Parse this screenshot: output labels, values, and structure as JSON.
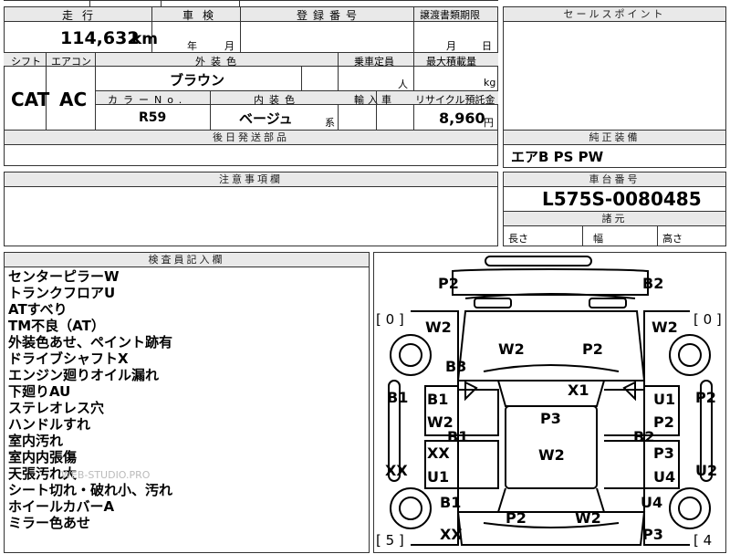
{
  "top_sheet": {
    "mileage_label": "走行",
    "inspection_label": "車検",
    "registration_label": "登録番号",
    "transfer_deadline_label": "譲渡書類期限",
    "mileage_value": "114,632",
    "mileage_unit": "km",
    "inspection_year_unit": "年",
    "inspection_month_unit": "月",
    "transfer_month_unit": "月",
    "transfer_day_unit": "日",
    "shift_label": "シフト",
    "aircon_label": "エアコン",
    "exterior_color_label": "外装色",
    "capacity_label": "乗車定員",
    "max_load_label": "最大積載量",
    "shift_value": "CAT",
    "aircon_value": "AC",
    "exterior_color_value": "ブラウン",
    "capacity_unit": "人",
    "max_load_unit": "kg",
    "color_no_label": "カラーNo.",
    "interior_color_label": "内装色",
    "import_label": "輸入車",
    "recycle_label": "リサイクル預託金",
    "color_no_value": "R59",
    "interior_color_value": "ベージュ",
    "interior_color_suffix": "系",
    "recycle_value": "8,960",
    "recycle_unit": "円",
    "later_parts_label": "後日発送部品",
    "notes_label": "注意事項欄"
  },
  "sales_point": {
    "label": "セールスポイント",
    "equipment_label": "純正装備",
    "equipment_value": "エアB PS PW"
  },
  "chassis": {
    "label": "車台番号",
    "value": "L575S-0080485",
    "dimensions_label": "諸元",
    "length_label": "長さ",
    "width_label": "幅",
    "height_label": "高さ"
  },
  "inspector": {
    "label": "検査員記入欄",
    "remarks": [
      "センターピラーW",
      "トランクフロアU",
      "ATすべり",
      "TM不良（AT）",
      "外装色あせ、ペイント跡有",
      "ドライブシャフトX",
      "エンジン廻りオイル漏れ",
      "下廻りAU",
      "ステレオレス穴",
      "ハンドルすれ",
      "室内汚れ",
      "室内内張傷",
      "天張汚れ大",
      "シート切れ・破れ小、汚れ",
      "ホイールカバーA",
      "ミラー色あせ"
    ],
    "watermark": "WEB-STUDIO.PRO"
  },
  "diagram": {
    "marks": {
      "top_left_p2": "P2",
      "top_right_b2": "B2",
      "bracket_tl": "[ 0 ]",
      "bracket_tr": "[ 0 ]",
      "bracket_bl": "[ 5 ]",
      "bracket_br": "[ 4",
      "front_left_w2": "W2",
      "front_right_w2": "W2",
      "hood_w2": "W2",
      "hood_p2": "P2",
      "b3": "B3",
      "x1": "X1",
      "left_b1_outer": "B1",
      "left_b1": "B1",
      "left_w2": "W2",
      "left_b1_low": "B1",
      "left_xx": "XX",
      "left_u1": "U1",
      "left_xx_outer": "XX",
      "roof_p3": "P3",
      "roof_w2": "W2",
      "right_u1": "U1",
      "right_p2_outer": "P2",
      "right_p2": "P2",
      "right_b2": "B2",
      "right_p3": "P3",
      "right_u4": "U4",
      "right_u2_outer": "U2",
      "rear_left_b1": "B1",
      "rear_left_xx": "XX",
      "rear_p2": "P2",
      "rear_w2": "W2",
      "rear_right_u4": "U4",
      "rear_right_p3": "P3"
    }
  }
}
